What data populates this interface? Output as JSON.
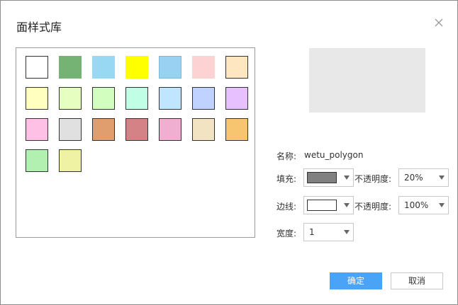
{
  "dialog": {
    "title": "面样式库"
  },
  "swatches": [
    {
      "fill": "#ffffff",
      "border": "#333333"
    },
    {
      "fill": "#74b374",
      "border": "#74b374"
    },
    {
      "fill": "#99d8f2",
      "border": "#99d8f2"
    },
    {
      "fill": "#ffff00",
      "border": "#ffff00"
    },
    {
      "fill": "#99d1f2",
      "border": "#7fb6d9"
    },
    {
      "fill": "#fdd2d2",
      "border": "#fdd2d2"
    },
    {
      "fill": "#fde6c0",
      "border": "#333333"
    },
    {
      "fill": "#ffffc0",
      "border": "#333333"
    },
    {
      "fill": "#e6ffc0",
      "border": "#333333"
    },
    {
      "fill": "#d2ffc0",
      "border": "#333333"
    },
    {
      "fill": "#c0ffe6",
      "border": "#333333"
    },
    {
      "fill": "#c0e6ff",
      "border": "#333333"
    },
    {
      "fill": "#c0d2ff",
      "border": "#333333"
    },
    {
      "fill": "#e6c0ff",
      "border": "#333333"
    },
    {
      "fill": "#ffc0e6",
      "border": "#333333"
    },
    {
      "fill": "#e0e0e0",
      "border": "#333333"
    },
    {
      "fill": "#e09e6e",
      "border": "#333333"
    },
    {
      "fill": "#d48285",
      "border": "#333333"
    },
    {
      "fill": "#f0aed0",
      "border": "#333333"
    },
    {
      "fill": "#f2e4c2",
      "border": "#333333"
    },
    {
      "fill": "#f7c56f",
      "border": "#333333"
    },
    {
      "fill": "#b2f0b2",
      "border": "#333333"
    },
    {
      "fill": "#eff2a2",
      "border": "#333333"
    }
  ],
  "form": {
    "name_label": "名称:",
    "name_value": "wetu_polygon",
    "fill_label": "填充:",
    "fill_color": "#808080",
    "fill_opacity_label": "不透明度:",
    "fill_opacity": "20%",
    "stroke_label": "边线:",
    "stroke_color": "#ffffff",
    "stroke_opacity_label": "不透明度:",
    "stroke_opacity": "100%",
    "width_label": "宽度:",
    "width_value": "1"
  },
  "buttons": {
    "ok": "确定",
    "cancel": "取消"
  },
  "colors": {
    "accent": "#4aa3f5",
    "preview_bg": "#e8e8e8"
  }
}
